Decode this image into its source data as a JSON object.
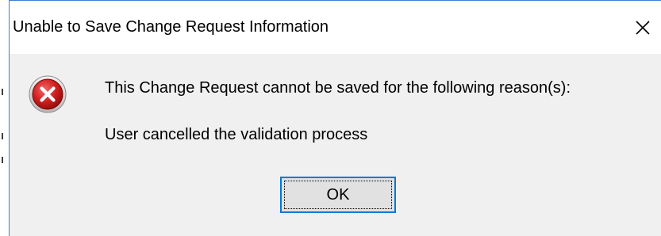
{
  "dialog": {
    "title": "Unable to Save Change Request Information",
    "close_icon": "close-icon",
    "icon": "error-icon",
    "message": "This Change Request cannot be saved for the following reason(s):",
    "reason": "User cancelled the validation process",
    "ok_label": "OK"
  },
  "colors": {
    "window_border": "#3c7fd6",
    "content_background": "#f0f0f0",
    "button_border": "#0078d7",
    "error_red": "#c8102e"
  }
}
